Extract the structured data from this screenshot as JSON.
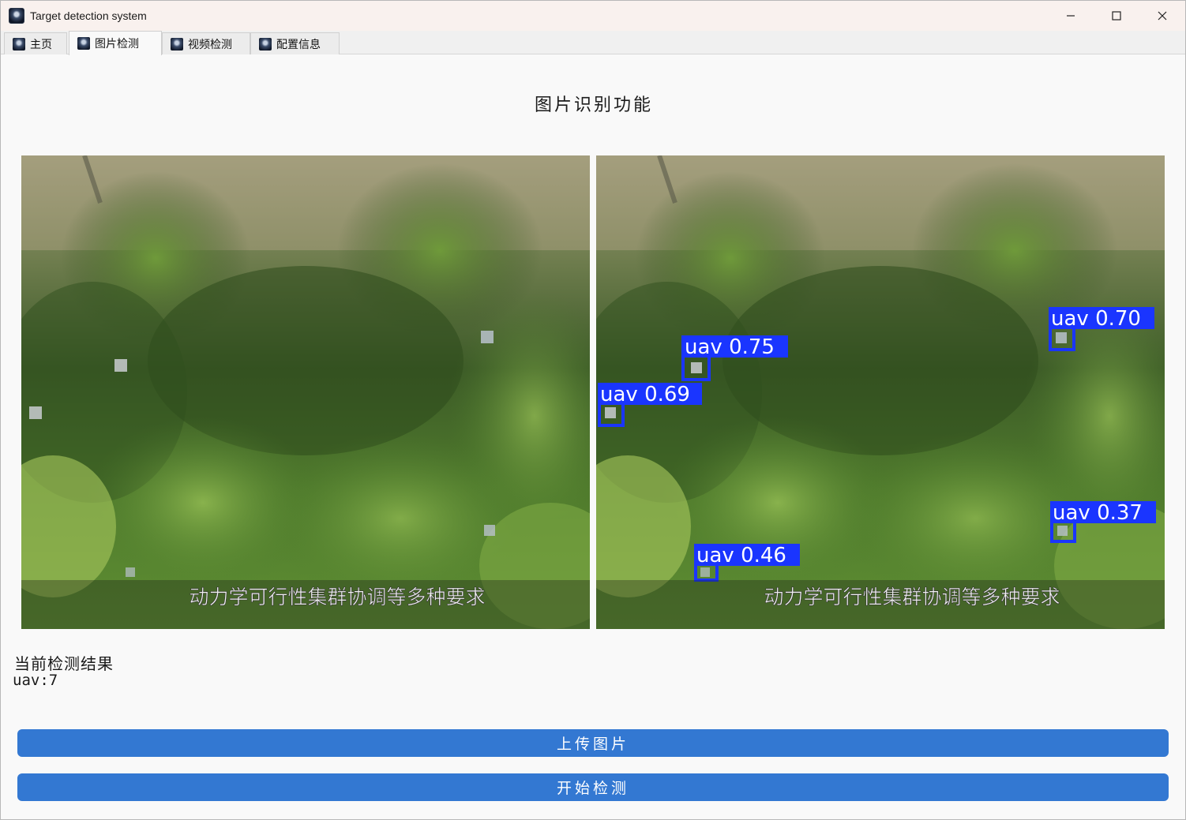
{
  "window": {
    "title": "Target detection system"
  },
  "tabs": [
    {
      "label": "主页"
    },
    {
      "label": "图片检测"
    },
    {
      "label": "视频检测"
    },
    {
      "label": "配置信息"
    }
  ],
  "page": {
    "title": "图片识别功能"
  },
  "images": {
    "subtitle_caption": "动力学可行性集群协调等多种要求",
    "detections": [
      {
        "label": "uav 0.75"
      },
      {
        "label": "uav 0.69"
      },
      {
        "label": "uav 0.70"
      },
      {
        "label": "uav 0.37"
      },
      {
        "label": "uav 0.46"
      }
    ]
  },
  "results": {
    "label": "当前检测结果",
    "value": "uav:7"
  },
  "buttons": {
    "upload": "上传图片",
    "start": "开始检测"
  },
  "colors": {
    "button_blue": "#3378d2",
    "box_blue": "#1a35ff"
  }
}
